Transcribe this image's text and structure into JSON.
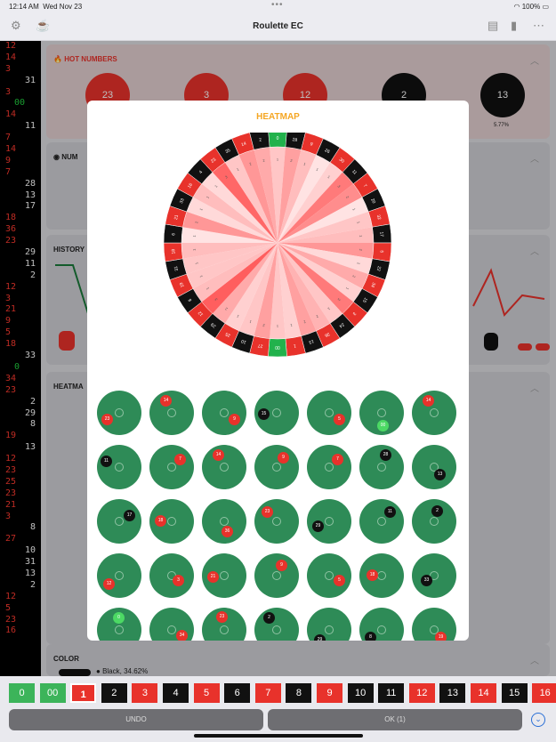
{
  "status": {
    "time": "12:14 AM",
    "date": "Wed Nov 23",
    "battery": "100%"
  },
  "nav": {
    "title": "Roulette EC"
  },
  "history_list": [
    {
      "n": "12",
      "c": "red"
    },
    {
      "n": "14",
      "c": "red"
    },
    {
      "n": "3",
      "c": "red"
    },
    {
      "n": "31",
      "c": "black"
    },
    {
      "n": "3",
      "c": "red"
    },
    {
      "n": "00",
      "c": "green"
    },
    {
      "n": "14",
      "c": "red"
    },
    {
      "n": "11",
      "c": "black"
    },
    {
      "n": "7",
      "c": "red"
    },
    {
      "n": "14",
      "c": "red"
    },
    {
      "n": "9",
      "c": "red"
    },
    {
      "n": "7",
      "c": "red"
    },
    {
      "n": "28",
      "c": "black"
    },
    {
      "n": "13",
      "c": "black"
    },
    {
      "n": "17",
      "c": "black"
    },
    {
      "n": "18",
      "c": "red"
    },
    {
      "n": "36",
      "c": "red"
    },
    {
      "n": "23",
      "c": "red"
    },
    {
      "n": "29",
      "c": "black"
    },
    {
      "n": "11",
      "c": "black"
    },
    {
      "n": "2",
      "c": "black"
    },
    {
      "n": "12",
      "c": "red"
    },
    {
      "n": "3",
      "c": "red"
    },
    {
      "n": "21",
      "c": "red"
    },
    {
      "n": "9",
      "c": "red"
    },
    {
      "n": "5",
      "c": "red"
    },
    {
      "n": "18",
      "c": "red"
    },
    {
      "n": "33",
      "c": "black"
    },
    {
      "n": "0",
      "c": "green"
    },
    {
      "n": "34",
      "c": "red"
    },
    {
      "n": "23",
      "c": "red"
    },
    {
      "n": "2",
      "c": "black"
    },
    {
      "n": "29",
      "c": "black"
    },
    {
      "n": "8",
      "c": "black"
    },
    {
      "n": "19",
      "c": "red"
    },
    {
      "n": "13",
      "c": "black"
    },
    {
      "n": "12",
      "c": "red"
    },
    {
      "n": "23",
      "c": "red"
    },
    {
      "n": "25",
      "c": "red"
    },
    {
      "n": "23",
      "c": "red"
    },
    {
      "n": "21",
      "c": "red"
    },
    {
      "n": "3",
      "c": "red"
    },
    {
      "n": "8",
      "c": "black"
    },
    {
      "n": "27",
      "c": "red"
    },
    {
      "n": "10",
      "c": "black"
    },
    {
      "n": "31",
      "c": "black"
    },
    {
      "n": "13",
      "c": "black"
    },
    {
      "n": "2",
      "c": "black"
    },
    {
      "n": "12",
      "c": "red"
    },
    {
      "n": "5",
      "c": "red"
    },
    {
      "n": "23",
      "c": "red"
    },
    {
      "n": "16",
      "c": "red"
    }
  ],
  "hot": {
    "label": "HOT NUMBERS",
    "balls": [
      {
        "n": "23",
        "c": "#e8322b"
      },
      {
        "n": "3",
        "c": "#e8322b"
      },
      {
        "n": "12",
        "c": "#e8322b"
      },
      {
        "n": "2",
        "c": "#111111"
      },
      {
        "n": "13",
        "c": "#111111"
      }
    ],
    "last_pct": "5.77%"
  },
  "sections": {
    "numbers": "NUM",
    "history": "HISTORY",
    "heatmap": "HEATMA",
    "color": "COLOR"
  },
  "color_section": {
    "black_label": "Black, 34.62%"
  },
  "keypad": [
    {
      "n": "0",
      "c": "#3cb45a"
    },
    {
      "n": "00",
      "c": "#3cb45a"
    },
    {
      "n": "1",
      "c": "#e8322b"
    },
    {
      "n": "2",
      "c": "#111111"
    },
    {
      "n": "3",
      "c": "#e8322b"
    },
    {
      "n": "4",
      "c": "#111111"
    },
    {
      "n": "5",
      "c": "#e8322b"
    },
    {
      "n": "6",
      "c": "#111111"
    },
    {
      "n": "7",
      "c": "#e8322b"
    },
    {
      "n": "8",
      "c": "#111111"
    },
    {
      "n": "9",
      "c": "#e8322b"
    },
    {
      "n": "10",
      "c": "#111111"
    },
    {
      "n": "11",
      "c": "#111111"
    },
    {
      "n": "12",
      "c": "#e8322b"
    },
    {
      "n": "13",
      "c": "#111111"
    },
    {
      "n": "14",
      "c": "#e8322b"
    },
    {
      "n": "15",
      "c": "#111111"
    },
    {
      "n": "16",
      "c": "#e8322b"
    }
  ],
  "buttons": {
    "undo": "UNDO",
    "ok": "OK (1)"
  },
  "heatmap": {
    "title": "HEATMAP",
    "wheel_order": [
      "0",
      "28",
      "9",
      "26",
      "30",
      "11",
      "7",
      "20",
      "32",
      "17",
      "5",
      "22",
      "34",
      "15",
      "3",
      "24",
      "36",
      "13",
      "1",
      "00",
      "27",
      "10",
      "25",
      "29",
      "12",
      "8",
      "19",
      "31",
      "18",
      "6",
      "21",
      "33",
      "16",
      "4",
      "23",
      "35",
      "14",
      "2"
    ],
    "wheel_colors": [
      "green",
      "black",
      "red",
      "black",
      "red",
      "black",
      "red",
      "black",
      "red",
      "black",
      "red",
      "black",
      "red",
      "black",
      "red",
      "black",
      "red",
      "black",
      "red",
      "green",
      "red",
      "black",
      "red",
      "black",
      "red",
      "black",
      "red",
      "black",
      "red",
      "black",
      "red",
      "black",
      "red",
      "black",
      "red",
      "black",
      "red",
      "black"
    ],
    "intensity": [
      0.3,
      0.5,
      0.35,
      0.15,
      0.25,
      0.7,
      0.6,
      0.15,
      0.3,
      0.35,
      0.55,
      0.2,
      0.45,
      0.25,
      0.7,
      0.3,
      0.4,
      0.5,
      0.25,
      0.3,
      0.5,
      0.3,
      0.25,
      0.45,
      0.85,
      0.35,
      0.3,
      0.3,
      0.35,
      0.15,
      0.55,
      0.2,
      0.35,
      0.2,
      0.8,
      0.3,
      0.55,
      0.45
    ],
    "cells": [
      {
        "n": "23",
        "c": "red"
      },
      {
        "n": "14",
        "c": "red"
      },
      {
        "n": "9",
        "c": "red"
      },
      {
        "n": "15",
        "c": "black"
      },
      {
        "n": "5",
        "c": "red"
      },
      {
        "n": "00",
        "c": "green"
      },
      {
        "n": "14",
        "c": "red"
      },
      {
        "n": "11",
        "c": "black"
      },
      {
        "n": "7",
        "c": "red"
      },
      {
        "n": "14",
        "c": "red"
      },
      {
        "n": "9",
        "c": "red"
      },
      {
        "n": "7",
        "c": "red"
      },
      {
        "n": "28",
        "c": "black"
      },
      {
        "n": "13",
        "c": "black"
      },
      {
        "n": "17",
        "c": "black"
      },
      {
        "n": "18",
        "c": "red"
      },
      {
        "n": "36",
        "c": "red"
      },
      {
        "n": "23",
        "c": "red"
      },
      {
        "n": "29",
        "c": "black"
      },
      {
        "n": "11",
        "c": "black"
      },
      {
        "n": "2",
        "c": "black"
      },
      {
        "n": "12",
        "c": "red"
      },
      {
        "n": "3",
        "c": "red"
      },
      {
        "n": "21",
        "c": "red"
      },
      {
        "n": "9",
        "c": "red"
      },
      {
        "n": "5",
        "c": "red"
      },
      {
        "n": "18",
        "c": "red"
      },
      {
        "n": "33",
        "c": "black"
      },
      {
        "n": "0",
        "c": "green"
      },
      {
        "n": "34",
        "c": "red"
      },
      {
        "n": "23",
        "c": "red"
      },
      {
        "n": "2",
        "c": "black"
      },
      {
        "n": "29",
        "c": "black"
      },
      {
        "n": "8",
        "c": "black"
      },
      {
        "n": "19",
        "c": "red"
      }
    ]
  }
}
